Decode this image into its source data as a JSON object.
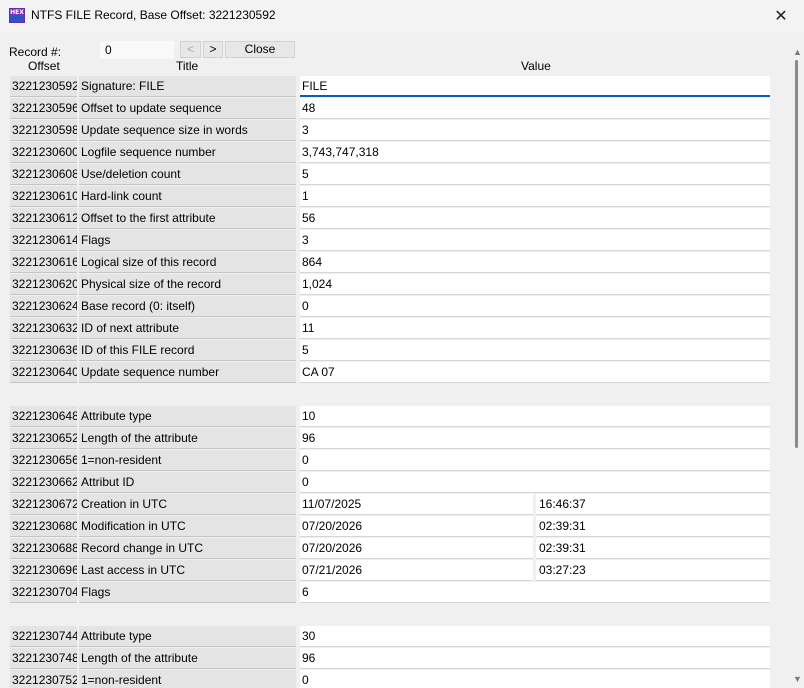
{
  "window": {
    "title": "NTFS FILE Record, Base Offset: 3221230592",
    "app_icon_text": "HEX",
    "close_glyph": "✕"
  },
  "toolbar": {
    "record_label": "Record #:",
    "record_value": "0",
    "prev_label": "<",
    "next_label": ">",
    "close_label": "Close"
  },
  "columns": {
    "offset": "Offset",
    "title": "Title",
    "value": "Value"
  },
  "rows": [
    {
      "offset": "3221230592",
      "title": "Signature: FILE",
      "value": "FILE"
    },
    {
      "offset": "3221230596",
      "title": "Offset to update sequence",
      "value": "48"
    },
    {
      "offset": "3221230598",
      "title": "Update sequence size in words",
      "value": "3"
    },
    {
      "offset": "3221230600",
      "title": "Logfile sequence number",
      "value": "3,743,747,318"
    },
    {
      "offset": "3221230608",
      "title": "Use/deletion count",
      "value": "5"
    },
    {
      "offset": "3221230610",
      "title": "Hard-link count",
      "value": "1"
    },
    {
      "offset": "3221230612",
      "title": "Offset to the first attribute",
      "value": "56"
    },
    {
      "offset": "3221230614",
      "title": "Flags",
      "value": "3"
    },
    {
      "offset": "3221230616",
      "title": "Logical size of this record",
      "value": "864"
    },
    {
      "offset": "3221230620",
      "title": "Physical size of the record",
      "value": "1,024"
    },
    {
      "offset": "3221230624",
      "title": "Base record (0: itself)",
      "value": "0"
    },
    {
      "offset": "3221230632",
      "title": "ID of next attribute",
      "value": "11"
    },
    {
      "offset": "3221230636",
      "title": "ID of this FILE record",
      "value": "5"
    },
    {
      "offset": "3221230640",
      "title": "Update sequence number",
      "value": "CA 07"
    },
    {
      "offset": "3221230648",
      "title": "Attribute type",
      "value": "10"
    },
    {
      "offset": "3221230652",
      "title": "Length of the attribute",
      "value": "96"
    },
    {
      "offset": "3221230656",
      "title": "1=non-resident",
      "value": "0"
    },
    {
      "offset": "3221230662",
      "title": "Attribut ID",
      "value": "0"
    },
    {
      "offset": "3221230672",
      "title": "Creation in UTC",
      "value": "11/07/2025",
      "value2": "16:46:37"
    },
    {
      "offset": "3221230680",
      "title": "Modification in UTC",
      "value": "07/20/2026",
      "value2": "02:39:31"
    },
    {
      "offset": "3221230688",
      "title": "Record change in UTC",
      "value": "07/20/2026",
      "value2": "02:39:31"
    },
    {
      "offset": "3221230696",
      "title": "Last access in UTC",
      "value": "07/21/2026",
      "value2": "03:27:23"
    },
    {
      "offset": "3221230704",
      "title": "Flags",
      "value": "6"
    },
    {
      "offset": "3221230744",
      "title": "Attribute type",
      "value": "30"
    },
    {
      "offset": "3221230748",
      "title": "Length of the attribute",
      "value": "96"
    },
    {
      "offset": "3221230752",
      "title": "1=non-resident",
      "value": "0"
    }
  ],
  "scrollbar": {
    "up_glyph": "▲",
    "down_glyph": "▼"
  }
}
